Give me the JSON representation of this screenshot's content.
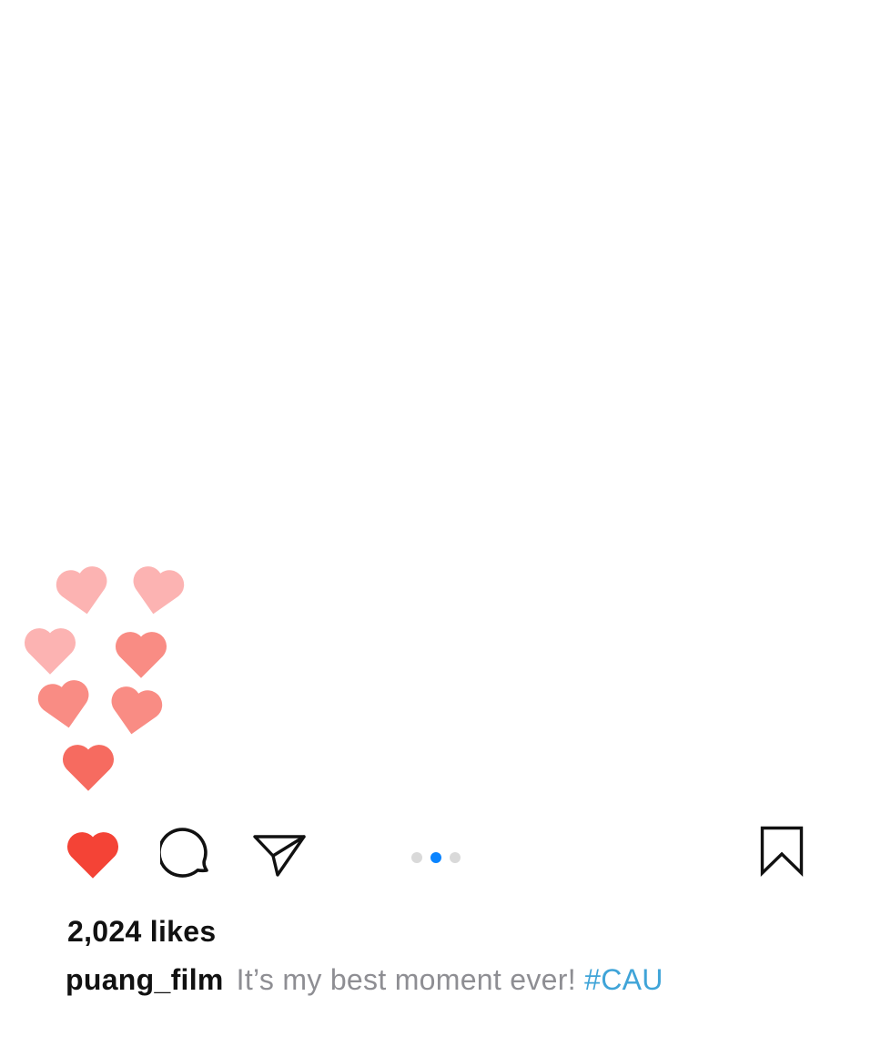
{
  "post": {
    "likes_text": "2,024 likes",
    "username": "puang_film",
    "caption_text": "It’s my best moment ever!",
    "hashtag": "#CAU",
    "carousel": {
      "total": 3,
      "active_index": 1
    },
    "liked": true
  },
  "icons": {
    "like": "heart-icon",
    "comment": "comment-bubble-icon",
    "share": "paper-plane-icon",
    "save": "bookmark-icon",
    "floating_hearts": "heart-icon"
  },
  "colors": {
    "liked_heart": "#f44336",
    "hashtag": "#3fa4d8",
    "caption_text": "#8e8e93",
    "active_dot": "#0a84ff",
    "inactive_dot": "#d9d9d9",
    "heart_light": "#fcb3b2",
    "heart_medium": "#f98c84",
    "heart_dark": "#f66b60"
  }
}
